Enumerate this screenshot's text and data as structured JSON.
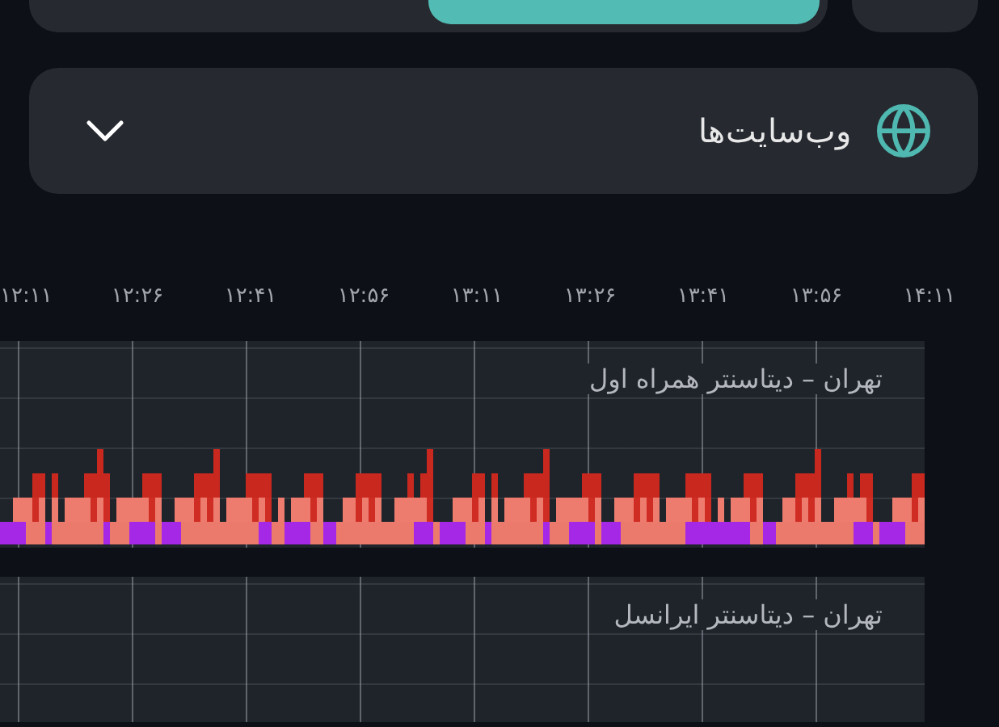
{
  "dropdown": {
    "label": "وب‌سایت‌ها",
    "expanded": false
  },
  "time_ticks": [
    "۱۴:۱۱",
    "۱۳:۵۶",
    "۱۳:۴۱",
    "۱۳:۲۶",
    "۱۳:۱۱",
    "۱۲:۵۶",
    "۱۲:۴۱",
    "۱۲:۲۶",
    "۱۲:۱۱"
  ],
  "panels": [
    {
      "title": "تهران – دیتاسنتر همراه اول",
      "kind": "bars"
    },
    {
      "title": "تهران – دیتاسنتر ایرانسل",
      "kind": "empty"
    }
  ]
}
